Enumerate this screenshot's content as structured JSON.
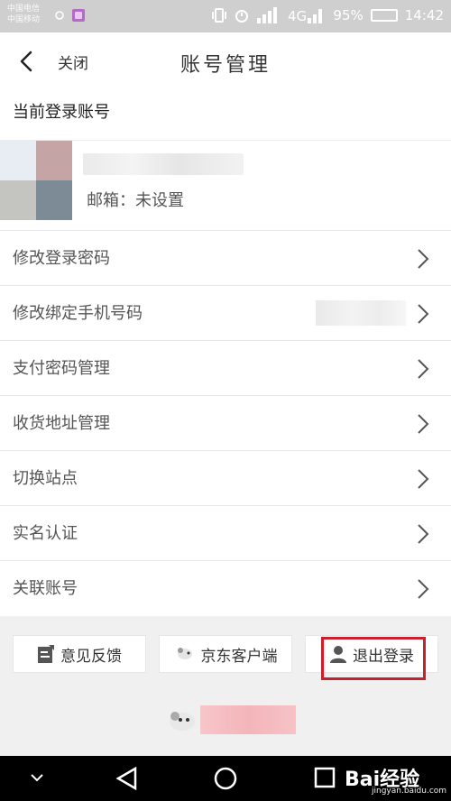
{
  "statusbar": {
    "carrier_line1": "中国电信",
    "carrier_line2": "中国移动",
    "battery": "95%",
    "time": "14:42"
  },
  "nav": {
    "close_label": "关闭",
    "title": "账号管理"
  },
  "section": {
    "current_account_label": "当前登录账号"
  },
  "profile": {
    "email_label": "邮箱：未设置"
  },
  "menu": {
    "items": [
      {
        "label": "修改登录密码"
      },
      {
        "label": "修改绑定手机号码"
      },
      {
        "label": "支付密码管理"
      },
      {
        "label": "收货地址管理"
      },
      {
        "label": "切换站点"
      },
      {
        "label": "实名认证"
      },
      {
        "label": "关联账号"
      }
    ]
  },
  "actions": {
    "feedback": "意见反馈",
    "jd_client": "京东客户端",
    "logout": "退出登录"
  },
  "watermark": {
    "brand": "Bai经验",
    "url": "jingyan.baidu.com"
  },
  "colors": {
    "highlight": "#c8202c",
    "statusbar": "#cfcfcf"
  }
}
